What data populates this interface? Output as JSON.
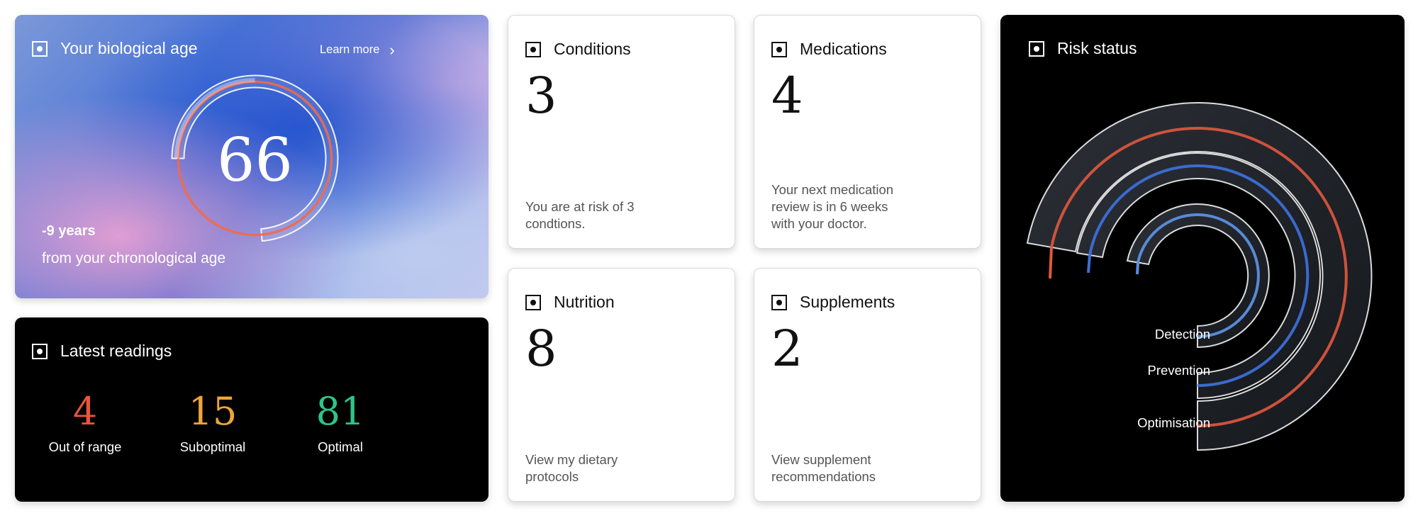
{
  "bio_age": {
    "title": "Your biological age",
    "learn_more": "Learn more",
    "age": "66",
    "delta": "-9 years",
    "subtitle": "from your chronological age"
  },
  "readings": {
    "title": "Latest readings",
    "items": [
      {
        "value": "4",
        "label": "Out of range",
        "color": "#e8553a"
      },
      {
        "value": "15",
        "label": "Suboptimal",
        "color": "#f0a43a"
      },
      {
        "value": "81",
        "label": "Optimal",
        "color": "#2fc489"
      }
    ]
  },
  "conditions": {
    "title": "Conditions",
    "count": "3",
    "description": "You are at risk of 3\ncondtions."
  },
  "medications": {
    "title": "Medications",
    "count": "4",
    "description": "Your next medication\nreview is in 6 weeks\nwith your doctor."
  },
  "nutrition": {
    "title": "Nutrition",
    "count": "8",
    "description": "View my dietary\nprotocols"
  },
  "supplements": {
    "title": "Supplements",
    "count": "2",
    "description": "View supplement\nrecommendations"
  },
  "risk": {
    "title": "Risk status",
    "rings": [
      {
        "label": "Detection",
        "color": "#5b8fe0"
      },
      {
        "label": "Prevention",
        "color": "#3c6fd8"
      },
      {
        "label": "Optimisation",
        "color": "#e2583f"
      }
    ]
  },
  "icons": {
    "card_icon": "target-square-icon",
    "chevron": "chevron-right-icon"
  }
}
